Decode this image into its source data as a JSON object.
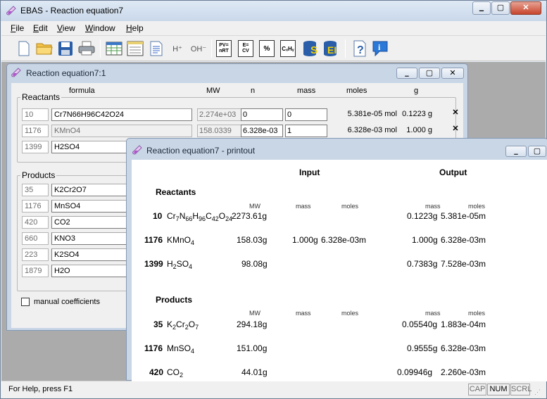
{
  "app": {
    "title": "EBAS - Reaction equation7"
  },
  "titlebar_buttons": {
    "min": "▁",
    "max": "▢",
    "close": "✕"
  },
  "menu": [
    "File",
    "Edit",
    "View",
    "Window",
    "Help"
  ],
  "toolbar": {
    "icons": [
      "new-document-icon",
      "open-folder-icon",
      "save-disk-icon",
      "print-icon",
      "table-view-icon",
      "form-view-icon",
      "report-view-icon",
      "h-plus-balance-icon",
      "oh-minus-balance-icon",
      "pv-nrt-icon",
      "e-cv-icon",
      "percent-calc-icon",
      "chxhy-calc-icon",
      "database-s-icon",
      "database-ei-icon",
      "context-help-icon",
      "about-info-icon"
    ],
    "pv_nrt": "PV=\nnRT",
    "e_cv": "E=\nCV",
    "h_plus": "H⁺",
    "oh_minus": "OH⁻"
  },
  "win1": {
    "title": "Reaction equation7:1",
    "headers": {
      "formula": "formula",
      "mw": "MW",
      "n": "n",
      "mass": "mass",
      "moles": "moles",
      "g": "g"
    },
    "reactants_label": "Reactants",
    "products_label": "Products",
    "reactants": [
      {
        "idx": "10",
        "formula": "Cr7N66H96C42O24",
        "mw": "2.274e+03",
        "n": "0",
        "mass": "0",
        "moles": "5.381e-05 mol",
        "g": "0.1223 g"
      },
      {
        "idx": "1176",
        "formula": "KMnO4",
        "mw": "158.0339",
        "n": "6.328e-03",
        "mass": "1",
        "moles": "6.328e-03 mol",
        "g": "1.000 g"
      },
      {
        "idx": "1399",
        "formula": "H2SO4"
      }
    ],
    "products": [
      {
        "idx": "35",
        "formula": "K2Cr2O7"
      },
      {
        "idx": "1176",
        "formula": "MnSO4"
      },
      {
        "idx": "420",
        "formula": "CO2"
      },
      {
        "idx": "660",
        "formula": "KNO3"
      },
      {
        "idx": "223",
        "formula": "K2SO4"
      },
      {
        "idx": "1879",
        "formula": "H2O"
      }
    ],
    "manual_coefficients": "manual coefficients"
  },
  "win2": {
    "title": "Reaction equation7 - printout",
    "input_label": "Input",
    "output_label": "Output",
    "reactants_label": "Reactants",
    "products_label": "Products",
    "col": {
      "mw": "MW",
      "mass": "mass",
      "moles": "moles"
    },
    "reactants": [
      {
        "idx": "10",
        "mw": "2273.61g",
        "in_mass": "",
        "in_moles": "",
        "out_mass": "0.1223g",
        "out_moles": "5.381e-05m"
      },
      {
        "idx": "1176",
        "mw": "158.03g",
        "in_mass": "1.000g",
        "in_moles": "6.328e-03m",
        "out_mass": "1.000g",
        "out_moles": "6.328e-03m"
      },
      {
        "idx": "1399",
        "mw": "98.08g",
        "in_mass": "",
        "in_moles": "",
        "out_mass": "0.7383g",
        "out_moles": "7.528e-03m"
      }
    ],
    "products": [
      {
        "idx": "35",
        "mw": "294.18g",
        "out_mass": "0.05540g",
        "out_moles": "1.883e-04m"
      },
      {
        "idx": "1176",
        "mw": "151.00g",
        "out_mass": "0.9555g",
        "out_moles": "6.328e-03m"
      },
      {
        "idx": "420",
        "mw": "44.01g",
        "out_mass": "0.09946g",
        "out_moles": "2.260e-03m"
      }
    ]
  },
  "status": {
    "help": "For Help, press F1",
    "cap": "CAP",
    "num": "NUM",
    "scrl": "SCRL"
  }
}
